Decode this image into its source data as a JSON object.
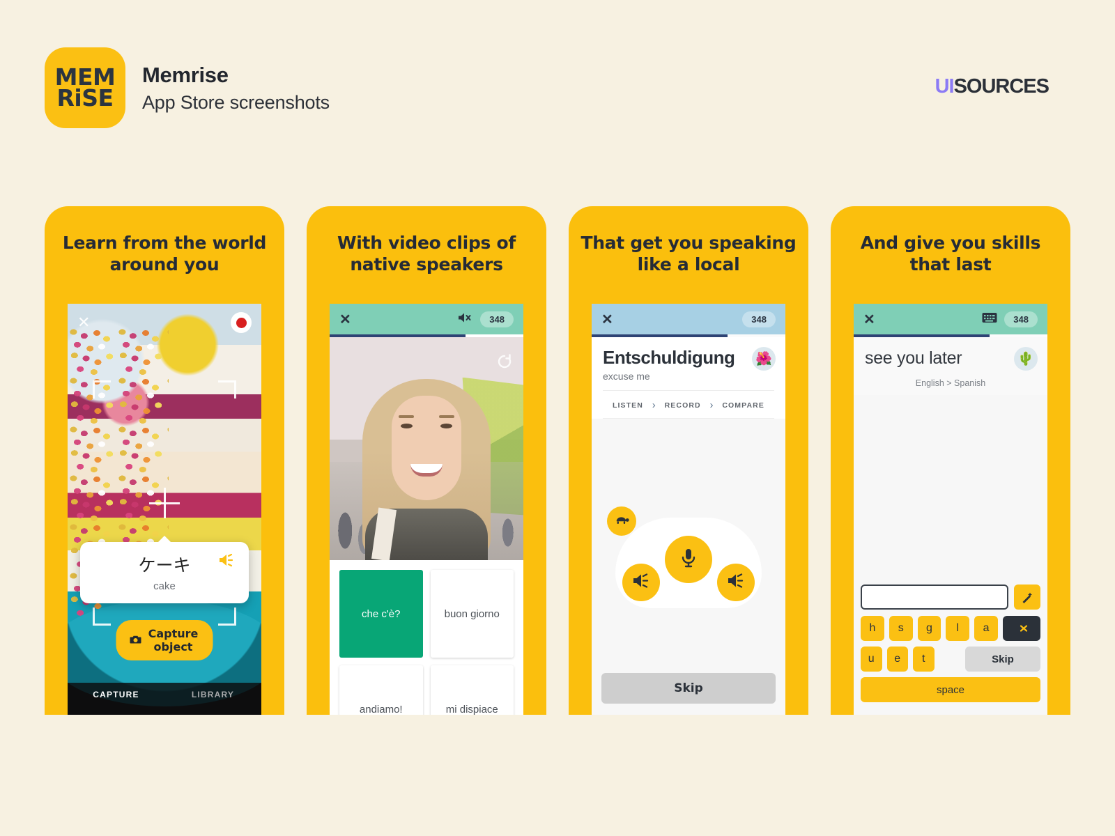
{
  "header": {
    "logo_line1": "MEM",
    "logo_line2": "RiSE",
    "title": "Memrise",
    "subtitle": "App Store screenshots",
    "watermark_prefix": "UI",
    "watermark_suffix": "SOURCES",
    "accent_yellow": "#FBC013",
    "background": "#F7F1E1",
    "watermark_accent": "#8C7BF5"
  },
  "panels": [
    {
      "title": "Learn from the world around you",
      "screen": {
        "close_icon": "close-icon",
        "record_icon": "record-dot-icon",
        "word_card": {
          "term": "ケーキ",
          "translation": "cake",
          "audio_icon": "speaker-icon"
        },
        "capture_button": {
          "label": "Capture object",
          "icon": "camera-icon"
        },
        "tabs": [
          {
            "label": "CAPTURE",
            "active": true
          },
          {
            "label": "LIBRARY",
            "active": false
          }
        ]
      }
    },
    {
      "title": "With video clips of native speakers",
      "screen": {
        "close_icon": "close-icon",
        "mute_icon": "speaker-muted-icon",
        "badge": "348",
        "progress_percent": 70,
        "header_color": "#7FCFB6",
        "replay_icon": "replay-icon",
        "tiles": [
          {
            "label": "che c'è?",
            "selected": true
          },
          {
            "label": "buon giorno",
            "selected": false
          },
          {
            "label": "andiamo!",
            "selected": false
          },
          {
            "label": "mi dispiace",
            "selected": false
          }
        ],
        "selected_color": "#08A676"
      }
    },
    {
      "title": "That get you speaking like a local",
      "screen": {
        "close_icon": "close-icon",
        "badge": "348",
        "progress_percent": 70,
        "header_color": "#A7D0E4",
        "term": "Entschuldigung",
        "translation": "excuse me",
        "avatar_icon": "flower-avatar-icon",
        "steps": [
          {
            "label": "LISTEN"
          },
          {
            "label": "RECORD"
          },
          {
            "label": "COMPARE"
          }
        ],
        "step_separator": "›",
        "buttons": [
          {
            "name": "slow-speed-button",
            "icon": "turtle-icon"
          },
          {
            "name": "record-button",
            "icon": "microphone-icon"
          },
          {
            "name": "play-left-button",
            "icon": "speaker-icon"
          },
          {
            "name": "play-right-button",
            "icon": "speaker-icon"
          }
        ],
        "skip_label": "Skip"
      }
    },
    {
      "title": "And give you skills that last",
      "screen": {
        "close_icon": "close-icon",
        "keyboard_icon": "keyboard-icon",
        "badge": "348",
        "progress_percent": 70,
        "header_color": "#7FCFB6",
        "term": "see you later",
        "direction": "English > Spanish",
        "avatar_icon": "cactus-avatar-icon",
        "answer_value": "",
        "hint_icon": "magic-wand-icon",
        "keys_row1": [
          "h",
          "s",
          "g",
          "l",
          "a"
        ],
        "delete_icon": "backspace-icon",
        "keys_row2": [
          "u",
          "e",
          "t"
        ],
        "skip_label": "Skip",
        "space_label": "space"
      }
    }
  ]
}
